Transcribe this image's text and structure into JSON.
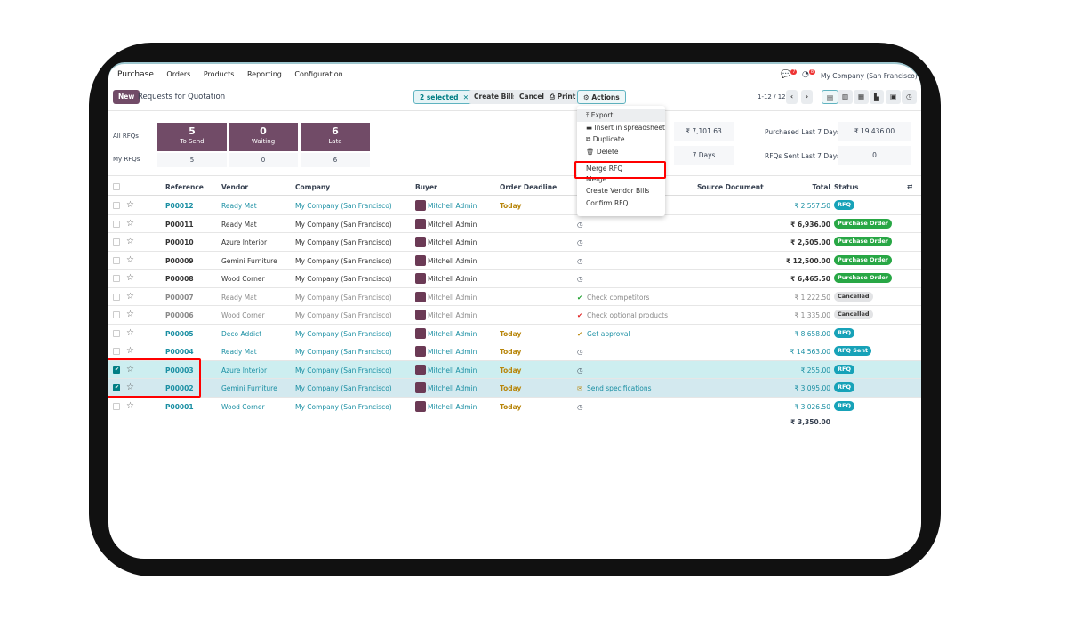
{
  "nav": {
    "app": "Purchase",
    "menus": [
      "Orders",
      "Products",
      "Reporting",
      "Configuration"
    ],
    "messages_count": "7",
    "activities_count": "8",
    "company": "My Company (San Francisco)"
  },
  "control": {
    "new": "New",
    "title": "Requests for Quotation",
    "selected": "2 selected",
    "create_bills": "Create Bills",
    "cancel": "Cancel",
    "print": "Print",
    "actions": "Actions",
    "pager": "1-12 / 12"
  },
  "actions_menu": [
    "Export",
    "Insert in spreadsheet",
    "Duplicate",
    "Delete",
    "Merge RFQ",
    "Merge",
    "Create Vendor Bills",
    "Confirm RFQ"
  ],
  "dashboard": {
    "all_label": "All RFQs",
    "my_label": "My RFQs",
    "tiles": [
      {
        "value": "5",
        "label": "To Send",
        "mine": "5"
      },
      {
        "value": "0",
        "label": "Waiting",
        "mine": "0"
      },
      {
        "value": "6",
        "label": "Late",
        "mine": "6"
      }
    ],
    "avg_order": "₹ 7,101.63",
    "lead_time": "7 Days",
    "purchased_label": "Purchased Last 7 Days",
    "purchased_value": "₹ 19,436.00",
    "sent_label": "RFQs Sent Last 7 Days",
    "sent_value": "0"
  },
  "columns": [
    "Reference",
    "Vendor",
    "Company",
    "Buyer",
    "Order Deadline",
    "Source Document",
    "Total",
    "Status"
  ],
  "rows": [
    {
      "ref": "P00012",
      "vendor": "Ready Mat",
      "company": "My Company (San Francisco)",
      "buyer": "Mitchell Admin",
      "deadline": "Today",
      "activity": "",
      "total": "₹ 2,557.50",
      "status": "RFQ",
      "kind": "rfq",
      "selected": false
    },
    {
      "ref": "P00011",
      "vendor": "Ready Mat",
      "company": "My Company (San Francisco)",
      "buyer": "Mitchell Admin",
      "deadline": "",
      "activity": "clock",
      "total": "₹ 6,936.00",
      "status": "Purchase Order",
      "kind": "po",
      "selected": false
    },
    {
      "ref": "P00010",
      "vendor": "Azure Interior",
      "company": "My Company (San Francisco)",
      "buyer": "Mitchell Admin",
      "deadline": "",
      "activity": "clock",
      "total": "₹ 2,505.00",
      "status": "Purchase Order",
      "kind": "po",
      "selected": false
    },
    {
      "ref": "P00009",
      "vendor": "Gemini Furniture",
      "company": "My Company (San Francisco)",
      "buyer": "Mitchell Admin",
      "deadline": "",
      "activity": "clock",
      "total": "₹ 12,500.00",
      "status": "Purchase Order",
      "kind": "po",
      "selected": false
    },
    {
      "ref": "P00008",
      "vendor": "Wood Corner",
      "company": "My Company (San Francisco)",
      "buyer": "Mitchell Admin",
      "deadline": "",
      "activity": "clock",
      "total": "₹ 6,465.50",
      "status": "Purchase Order",
      "kind": "po",
      "selected": false
    },
    {
      "ref": "P00007",
      "vendor": "Ready Mat",
      "company": "My Company (San Francisco)",
      "buyer": "Mitchell Admin",
      "deadline": "",
      "activity": "Check competitors",
      "act_icon": "check-green",
      "total": "₹ 1,222.50",
      "status": "Cancelled",
      "kind": "cancel",
      "selected": false
    },
    {
      "ref": "P00006",
      "vendor": "Wood Corner",
      "company": "My Company (San Francisco)",
      "buyer": "Mitchell Admin",
      "deadline": "",
      "activity": "Check optional products",
      "act_icon": "check-red",
      "total": "₹ 1,335.00",
      "status": "Cancelled",
      "kind": "cancel",
      "selected": false
    },
    {
      "ref": "P00005",
      "vendor": "Deco Addict",
      "company": "My Company (San Francisco)",
      "buyer": "Mitchell Admin",
      "deadline": "Today",
      "activity": "Get approval",
      "act_icon": "check-orange",
      "total": "₹ 8,658.00",
      "status": "RFQ",
      "kind": "rfq",
      "selected": false
    },
    {
      "ref": "P00004",
      "vendor": "Ready Mat",
      "company": "My Company (San Francisco)",
      "buyer": "Mitchell Admin",
      "deadline": "Today",
      "activity": "clock",
      "total": "₹ 14,563.00",
      "status": "RFQ Sent",
      "kind": "rfq",
      "selected": false
    },
    {
      "ref": "P00003",
      "vendor": "Azure Interior",
      "company": "My Company (San Francisco)",
      "buyer": "Mitchell Admin",
      "deadline": "Today",
      "activity": "clock",
      "total": "₹ 255.00",
      "status": "RFQ",
      "kind": "rfq",
      "selected": true
    },
    {
      "ref": "P00002",
      "vendor": "Gemini Furniture",
      "company": "My Company (San Francisco)",
      "buyer": "Mitchell Admin",
      "deadline": "Today",
      "activity": "Send specifications",
      "act_icon": "envelope",
      "total": "₹ 3,095.00",
      "status": "RFQ",
      "kind": "rfq",
      "selected": true
    },
    {
      "ref": "P00001",
      "vendor": "Wood Corner",
      "company": "My Company (San Francisco)",
      "buyer": "Mitchell Admin",
      "deadline": "Today",
      "activity": "clock",
      "total": "₹ 3,026.50",
      "status": "RFQ",
      "kind": "rfq",
      "selected": false
    }
  ],
  "footer_total": "₹ 3,350.00",
  "colors": {
    "brand": "#714b67",
    "accent": "#017e84",
    "rfq": "#17a2b8",
    "po": "#28a745",
    "cancelled": "#e2e3e5",
    "deadline": "#b8860b"
  }
}
